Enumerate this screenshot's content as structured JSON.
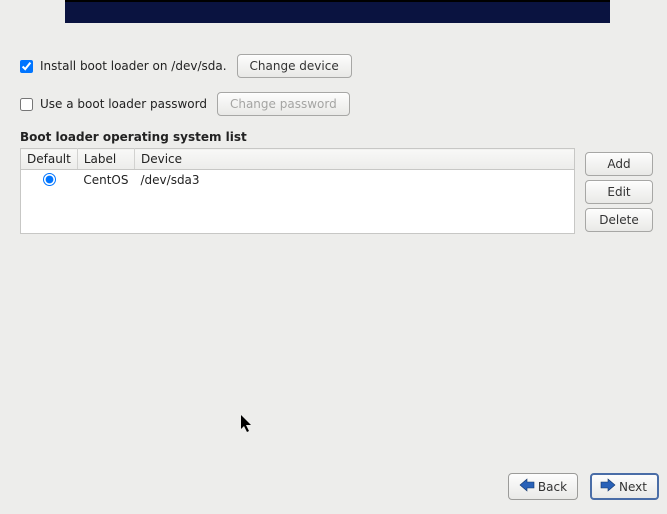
{
  "options": {
    "install_bootloader": {
      "checked": true,
      "label": "Install boot loader on /dev/sda.",
      "change_device_label": "Change device"
    },
    "use_password": {
      "checked": false,
      "label": "Use a boot loader password",
      "change_password_label": "Change password"
    }
  },
  "os_list": {
    "title": "Boot loader operating system list",
    "headers": {
      "default": "Default",
      "label": "Label",
      "device": "Device"
    },
    "rows": [
      {
        "default": true,
        "label": "CentOS",
        "device": "/dev/sda3"
      }
    ]
  },
  "side_buttons": {
    "add": "Add",
    "edit": "Edit",
    "delete": "Delete"
  },
  "nav": {
    "back": "Back",
    "next": "Next"
  }
}
